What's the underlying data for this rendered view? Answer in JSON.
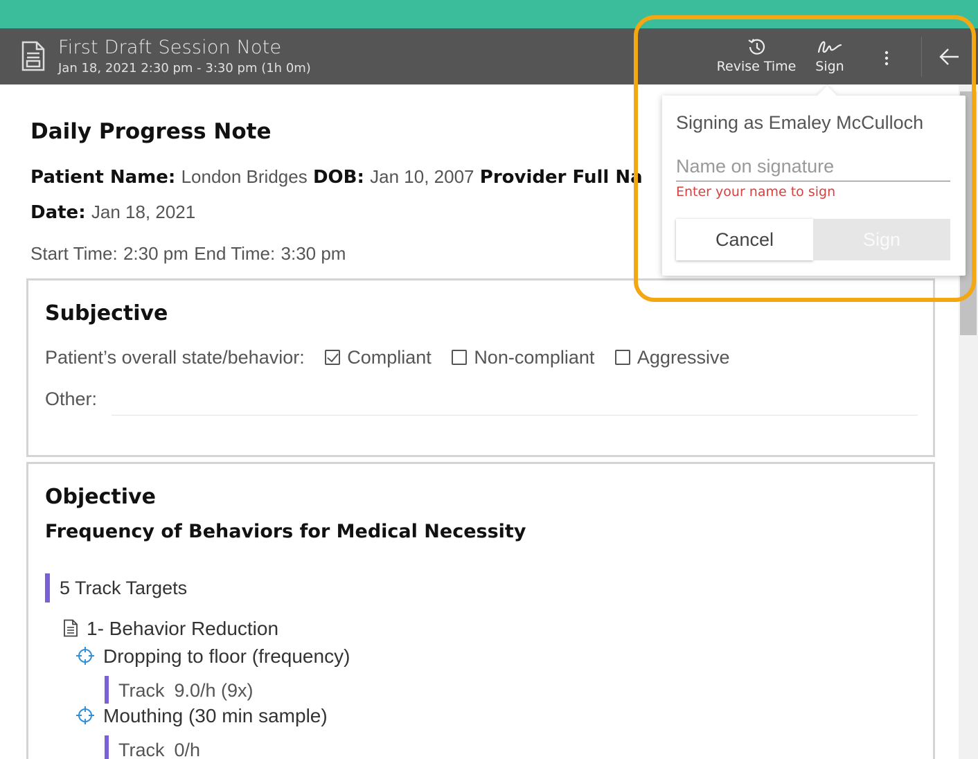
{
  "header": {
    "title": "First Draft Session Note",
    "subtitle": "Jan 18, 2021 2:30 pm - 3:30 pm (1h 0m)",
    "revise_label": "Revise Time",
    "sign_label": "Sign",
    "colors": {
      "top_strip": "#3bbd9b",
      "bar": "#555555"
    }
  },
  "note": {
    "title": "Daily Progress Note",
    "patient_label": "Patient Name:",
    "patient_value": "London Bridges",
    "dob_label": "DOB:",
    "dob_value": "Jan 10, 2007",
    "provider_label": "Provider Full Na",
    "date_label": "Date:",
    "date_value": "Jan 18, 2021",
    "start_label": "Start Time:",
    "start_value": "2:30 pm",
    "end_label": "End Time:",
    "end_value": "3:30 pm"
  },
  "subjective": {
    "title": "Subjective",
    "state_label": "Patient’s overall state/behavior:",
    "options": [
      {
        "label": "Compliant",
        "checked": true
      },
      {
        "label": "Non-compliant",
        "checked": false
      },
      {
        "label": "Aggressive",
        "checked": false
      }
    ],
    "other_label": "Other:"
  },
  "objective": {
    "title": "Objective",
    "subtitle": "Frequency of Behaviors for Medical Necessity",
    "targets_label": "5 Track Targets",
    "group_label": "1- Behavior Reduction",
    "behaviors": [
      {
        "name": "Dropping to floor (frequency)",
        "track_label": "Track",
        "track_value": "9.0/h (9x)"
      },
      {
        "name": "Mouthing (30 min sample)",
        "track_label": "Track",
        "track_value": "0/h"
      }
    ]
  },
  "sign_popup": {
    "signing_as": "Signing as Emaley McCulloch",
    "input_placeholder": "Name on signature",
    "input_value": "",
    "error": "Enter your name to sign",
    "cancel_label": "Cancel",
    "sign_label": "Sign",
    "colors": {
      "error": "#d84040",
      "highlight": "#f3a712",
      "track_bar": "#7b5fd6"
    }
  }
}
